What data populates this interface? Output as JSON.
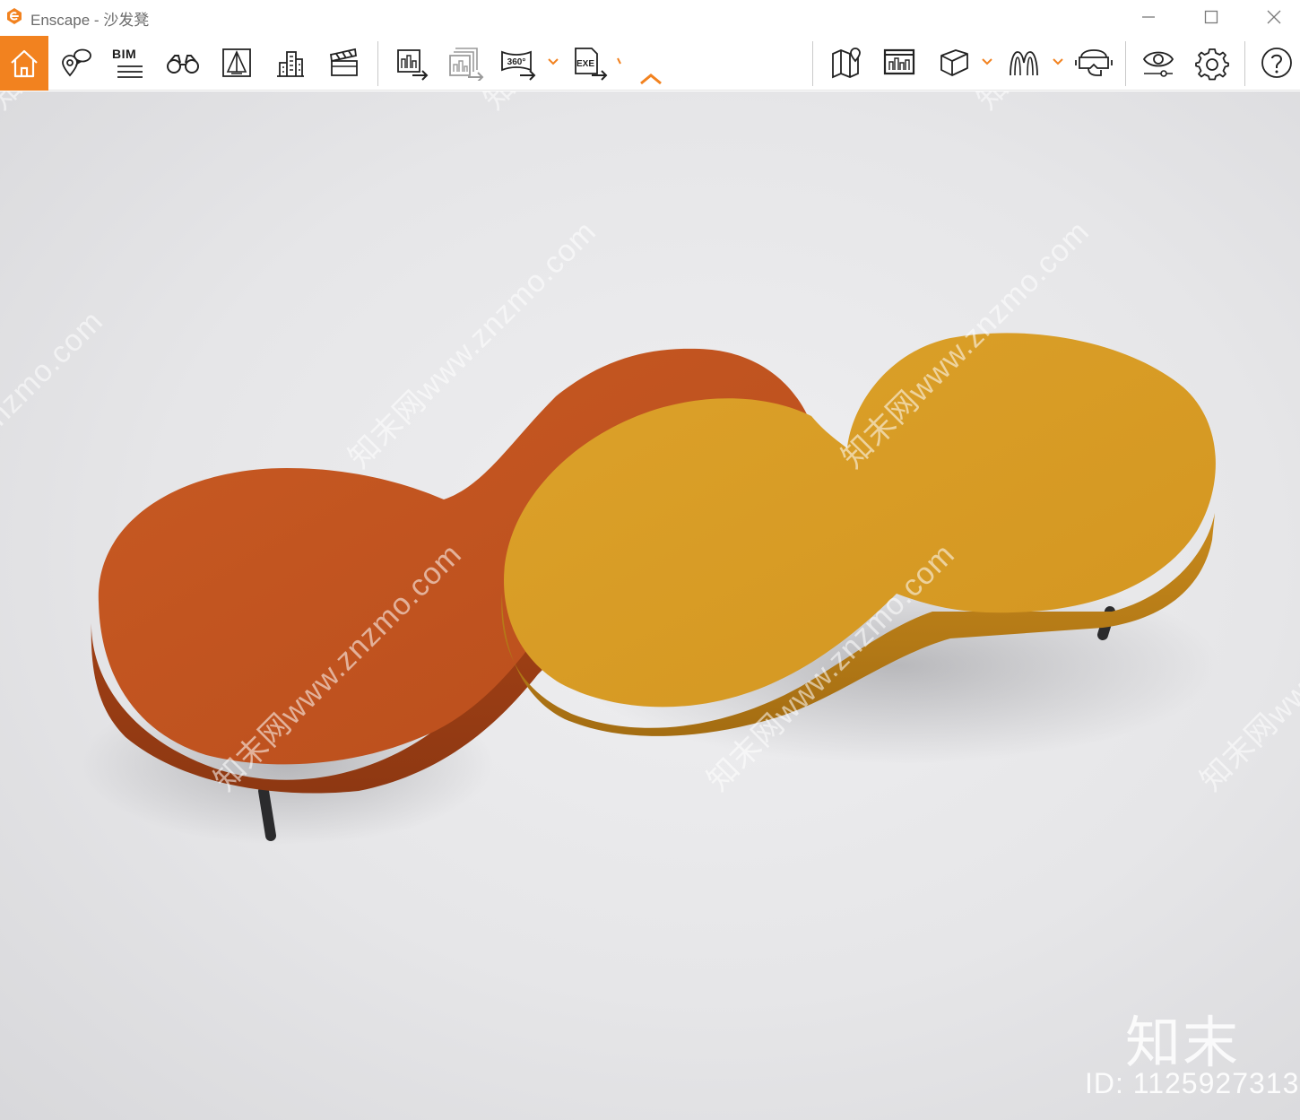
{
  "window": {
    "title": "Enscape - 沙发凳",
    "controls": [
      "minimize",
      "maximize",
      "close"
    ]
  },
  "toolbar": {
    "bim_label": "BIM",
    "buttons": [
      {
        "name": "home",
        "icon": "home-icon",
        "active": true
      },
      {
        "name": "views",
        "icon": "location-chat-icon"
      },
      {
        "name": "bim",
        "icon": "bim-icon"
      },
      {
        "name": "walk-mode",
        "icon": "binoculars-icon"
      },
      {
        "name": "perspective",
        "icon": "perspective-icon"
      },
      {
        "name": "buildings",
        "icon": "buildings-icon"
      },
      {
        "name": "video-editor",
        "icon": "clapperboard-icon"
      },
      {
        "name": "render-image",
        "icon": "render-image-icon"
      },
      {
        "name": "batch-render",
        "icon": "batch-render-icon"
      },
      {
        "name": "export-360",
        "icon": "panorama-360-icon",
        "label": "360°"
      },
      {
        "name": "export-exe",
        "icon": "exe-export-icon",
        "label": "EXE"
      },
      {
        "name": "map",
        "icon": "map-icon"
      },
      {
        "name": "gallery",
        "icon": "gallery-icon"
      },
      {
        "name": "object",
        "icon": "box-icon"
      },
      {
        "name": "assets",
        "icon": "asset-library-icon"
      },
      {
        "name": "vr",
        "icon": "vr-headset-icon"
      },
      {
        "name": "visual-settings",
        "icon": "eye-settings-icon"
      },
      {
        "name": "settings",
        "icon": "gear-icon"
      },
      {
        "name": "help",
        "icon": "help-icon"
      }
    ],
    "accent_color": "#f2821f"
  },
  "watermarks": {
    "diagonal_text": "知末网www.znzmo.com",
    "brand": "知末",
    "id_text": "ID: 1125927313"
  }
}
